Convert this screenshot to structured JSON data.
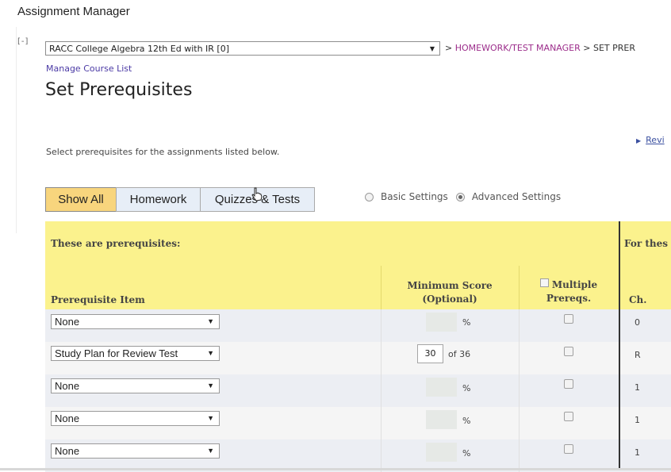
{
  "app": {
    "title": "Assignment Manager"
  },
  "header": {
    "collapse_label": "[-]",
    "course_selected": "RACC College Algebra 12th Ed with IR [0]",
    "breadcrumb_sep1": ">",
    "breadcrumb_link": "HOMEWORK/TEST MANAGER",
    "breadcrumb_sep2": ">",
    "breadcrumb_current": "SET PRER",
    "manage_link": "Manage Course List"
  },
  "page": {
    "title": "Set Prerequisites",
    "instructions": "Select prerequisites for the assignments listed below.",
    "review_link": "Revi"
  },
  "filters": {
    "tabs": [
      {
        "label": "Show All",
        "active": true
      },
      {
        "label": "Homework",
        "active": false
      },
      {
        "label": "Quizzes & Tests",
        "active": false
      }
    ]
  },
  "settings": {
    "basic_label": "Basic Settings",
    "advanced_label": "Advanced Settings",
    "selected": "advanced"
  },
  "table": {
    "section_left": "These are prerequisites:",
    "section_right": "For thes",
    "col_item": "Prerequisite Item",
    "col_min_line1": "Minimum Score",
    "col_min_line2": "(Optional)",
    "col_multi_line1": "Multiple",
    "col_multi_line2": "Prereqs.",
    "col_ch": "Ch.",
    "rows": [
      {
        "item": "None",
        "score": "",
        "of": "",
        "pct": "%",
        "ch": "0"
      },
      {
        "item": "Study Plan for Review Test",
        "score": "30",
        "of": "of  36",
        "pct": "",
        "ch": "R"
      },
      {
        "item": "None",
        "score": "",
        "of": "",
        "pct": "%",
        "ch": "1"
      },
      {
        "item": "None",
        "score": "",
        "of": "",
        "pct": "%",
        "ch": "1"
      },
      {
        "item": "None",
        "score": "",
        "of": "",
        "pct": "%",
        "ch": "1"
      }
    ]
  },
  "colors": {
    "header_yellow": "#fbf28d",
    "tab_active": "#f8d57d",
    "tab_inactive": "#e7eef7",
    "link_purple": "#9c2d8b"
  }
}
